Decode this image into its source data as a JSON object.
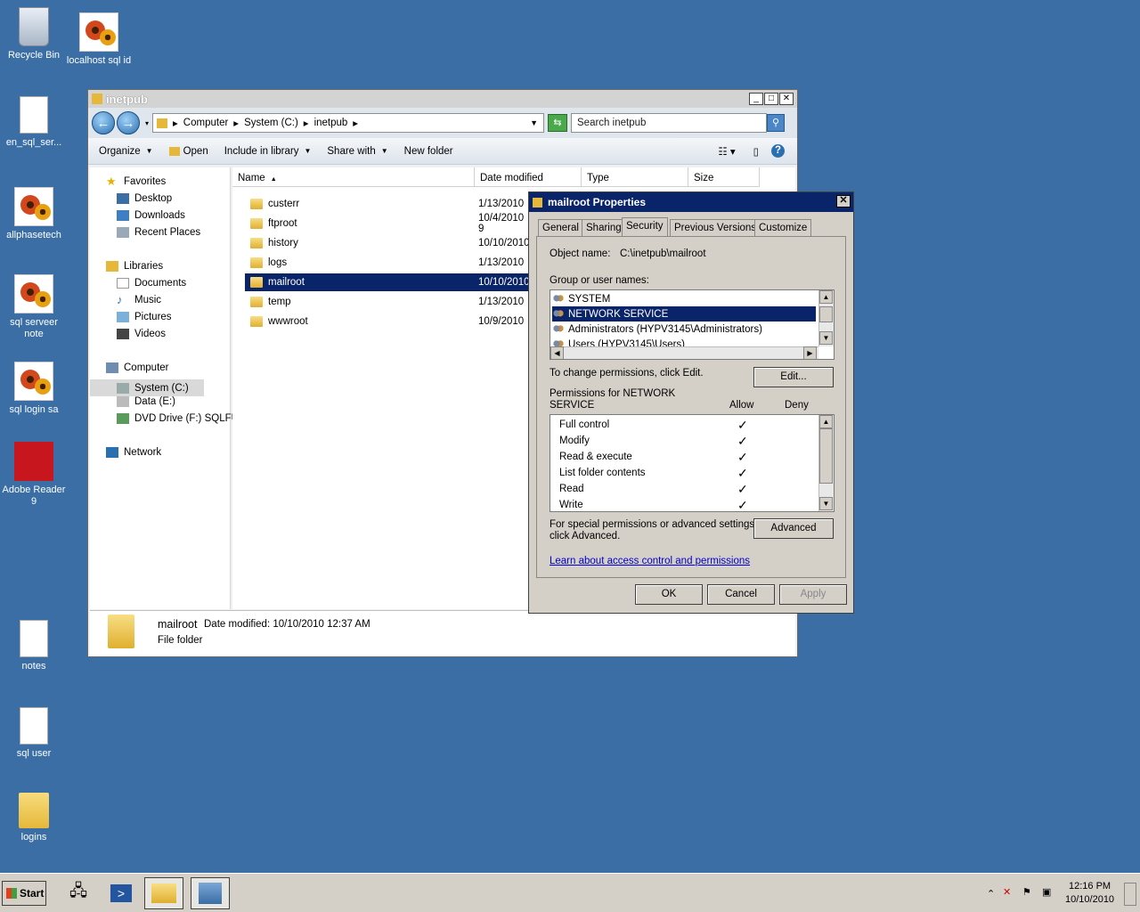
{
  "desktop": {
    "icons": [
      {
        "label": "Recycle Bin"
      },
      {
        "label": "localhost sql id"
      },
      {
        "label": "en_sql_ser..."
      },
      {
        "label": "allphasetech"
      },
      {
        "label": "sql serveer note"
      },
      {
        "label": "sql login sa"
      },
      {
        "label": "Adobe Reader 9"
      },
      {
        "label": "notes"
      },
      {
        "label": "sql user"
      },
      {
        "label": "logins"
      }
    ]
  },
  "explorer": {
    "title": "inetpub",
    "address": {
      "parts": [
        "Computer",
        "System (C:)",
        "inetpub"
      ]
    },
    "search": {
      "placeholder": "Search inetpub"
    },
    "commands": {
      "organize": "Organize",
      "open": "Open",
      "include": "Include in library",
      "share": "Share with",
      "new_folder": "New folder"
    },
    "nav": {
      "favorites": "Favorites",
      "desktop": "Desktop",
      "downloads": "Downloads",
      "recent": "Recent Places",
      "libraries": "Libraries",
      "documents": "Documents",
      "music": "Music",
      "pictures": "Pictures",
      "videos": "Videos",
      "computer": "Computer",
      "system_c": "System (C:)",
      "data_e": "Data (E:)",
      "dvd": "DVD Drive (F:) SQLFUL",
      "network": "Network"
    },
    "columns": {
      "name": "Name",
      "date": "Date modified",
      "type": "Type",
      "size": "Size"
    },
    "rows": [
      {
        "name": "custerr",
        "date": "1/13/2010"
      },
      {
        "name": "ftproot",
        "date": "10/4/2010 9"
      },
      {
        "name": "history",
        "date": "10/10/2010"
      },
      {
        "name": "logs",
        "date": "1/13/2010"
      },
      {
        "name": "mailroot",
        "date": "10/10/2010"
      },
      {
        "name": "temp",
        "date": "1/13/2010"
      },
      {
        "name": "wwwroot",
        "date": "10/9/2010"
      }
    ],
    "details": {
      "name": "mailroot",
      "modified": "Date modified: 10/10/2010 12:37 AM",
      "kind": "File folder"
    }
  },
  "dialog": {
    "title": "mailroot Properties",
    "tabs": [
      "General",
      "Sharing",
      "Security",
      "Previous Versions",
      "Customize"
    ],
    "object_label": "Object name:",
    "object_value": "C:\\inetpub\\mailroot",
    "group_label": "Group or user names:",
    "users": [
      "SYSTEM",
      "NETWORK SERVICE",
      "Administrators (HYPV3145\\Administrators)",
      "Users (HYPV3145\\Users)"
    ],
    "change_text": "To change permissions, click Edit.",
    "edit_button": "Edit...",
    "perm_label_1": "Permissions for NETWORK",
    "perm_label_2": "SERVICE",
    "allow": "Allow",
    "deny": "Deny",
    "permissions": [
      {
        "name": "Full control",
        "allow": "✓"
      },
      {
        "name": "Modify",
        "allow": "✓"
      },
      {
        "name": "Read & execute",
        "allow": "✓"
      },
      {
        "name": "List folder contents",
        "allow": "✓"
      },
      {
        "name": "Read",
        "allow": "✓"
      },
      {
        "name": "Write",
        "allow": "✓"
      }
    ],
    "special_1": "For special permissions or advanced settings,",
    "special_2": "click Advanced.",
    "advanced_button": "Advanced",
    "learn_link": "Learn about access control and permissions",
    "ok": "OK",
    "cancel": "Cancel",
    "apply": "Apply"
  },
  "taskbar": {
    "start": "Start",
    "time": "12:16 PM",
    "date": "10/10/2010"
  }
}
